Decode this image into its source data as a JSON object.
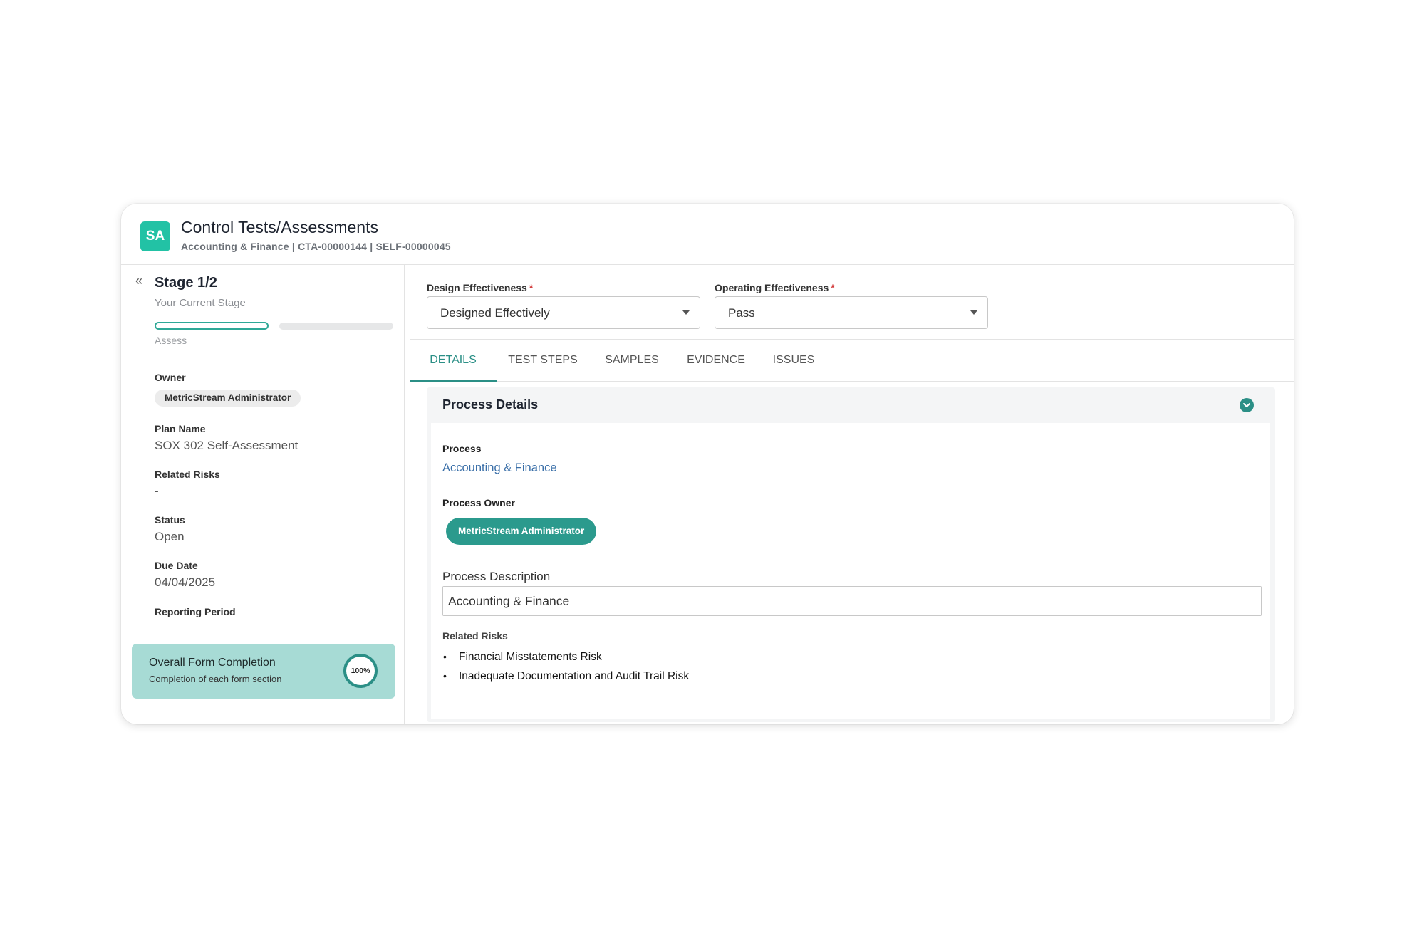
{
  "header": {
    "avatar_initials": "SA",
    "title": "Control Tests/Assessments",
    "subtitle": "Accounting & Finance | CTA-00000144 | SELF-00000045"
  },
  "sidebar": {
    "collapse_icon": "double-chevron-left-icon",
    "stage_title": "Stage 1/2",
    "stage_subtitle": "Your Current Stage",
    "stage_label": "Assess",
    "owner_label": "Owner",
    "owner_value": "MetricStream Administrator",
    "plan_name_label": "Plan Name",
    "plan_name_value": "SOX 302 Self-Assessment",
    "related_risks_label": "Related Risks",
    "related_risks_value": "-",
    "status_label": "Status",
    "status_value": "Open",
    "due_date_label": "Due Date",
    "due_date_value": "04/04/2025",
    "reporting_period_label": "Reporting Period",
    "completion": {
      "title": "Overall Form Completion",
      "subtitle": "Completion of each form section",
      "percent_label": "100%",
      "percent": 100
    }
  },
  "form": {
    "design_label": "Design Effectiveness",
    "design_value": "Designed Effectively",
    "operating_label": "Operating Effectiveness",
    "operating_value": "Pass",
    "required_mark": "*"
  },
  "tabs": [
    {
      "label": "DETAILS",
      "active": true
    },
    {
      "label": "TEST STEPS",
      "active": false
    },
    {
      "label": "SAMPLES",
      "active": false
    },
    {
      "label": "EVIDENCE",
      "active": false
    },
    {
      "label": "ISSUES",
      "active": false
    }
  ],
  "process_details": {
    "title": "Process Details",
    "toggle_icon": "chevron-down-circle-icon",
    "process_label": "Process",
    "process_value": "Accounting & Finance",
    "owner_label": "Process Owner",
    "owner_value": "MetricStream Administrator",
    "description_label": "Process Description",
    "description_value": "Accounting & Finance",
    "related_risks_label": "Related Risks",
    "related_risks": [
      "Financial Misstatements Risk",
      "Inadequate Documentation and Audit Trail Risk"
    ]
  },
  "colors": {
    "accent": "#2b8f86",
    "avatar": "#22c2a5",
    "completion_bg": "#a7dbd5",
    "link": "#3a6fa8",
    "required": "#d23b3b"
  }
}
